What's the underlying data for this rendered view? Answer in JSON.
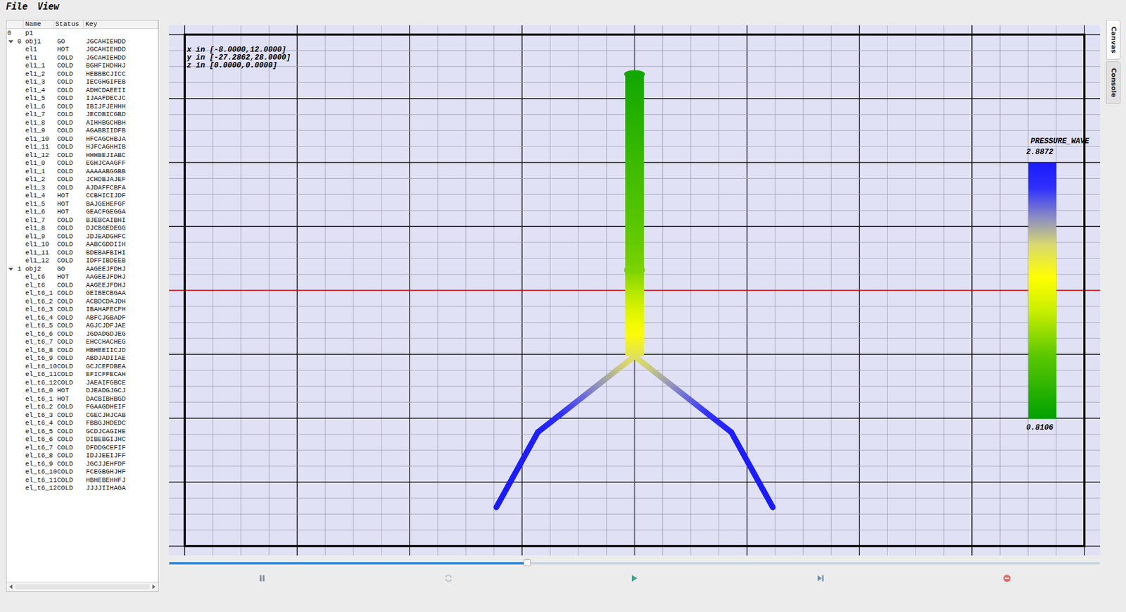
{
  "menu": [
    "File",
    "View"
  ],
  "tree": {
    "columns": [
      "Name",
      "Status",
      "Key"
    ],
    "rows": [
      {
        "kind": "root",
        "index": "0",
        "name": "p1"
      },
      {
        "kind": "group",
        "index": "0",
        "name": "obj1",
        "status": "GO",
        "key": "JGCAHIEHDD",
        "expanded": true
      },
      {
        "kind": "item",
        "name": "el1",
        "status": "HOT",
        "key": "JGCAHIEHDD"
      },
      {
        "kind": "item",
        "name": "el1",
        "status": "COLD",
        "key": "JGCAHIEHDD"
      },
      {
        "kind": "item",
        "name": "el1_1",
        "status": "COLD",
        "key": "BGHFIHDHHJ"
      },
      {
        "kind": "item",
        "name": "el1_2",
        "status": "COLD",
        "key": "HEBBBCJICC"
      },
      {
        "kind": "item",
        "name": "el1_3",
        "status": "COLD",
        "key": "IECGHGIFEB"
      },
      {
        "kind": "item",
        "name": "el1_4",
        "status": "COLD",
        "key": "ADHCDAEEII"
      },
      {
        "kind": "item",
        "name": "el1_5",
        "status": "COLD",
        "key": "IJAAFDECJC"
      },
      {
        "kind": "item",
        "name": "el1_6",
        "status": "COLD",
        "key": "IBIJFJEHHH"
      },
      {
        "kind": "item",
        "name": "el1_7",
        "status": "COLD",
        "key": "JECDBICGBD"
      },
      {
        "kind": "item",
        "name": "el1_8",
        "status": "COLD",
        "key": "AIHHBGCHBH"
      },
      {
        "kind": "item",
        "name": "el1_9",
        "status": "COLD",
        "key": "AGABBIIDFB"
      },
      {
        "kind": "item",
        "name": "el1_10",
        "status": "COLD",
        "key": "HFCAGCHBJA"
      },
      {
        "kind": "item",
        "name": "el1_11",
        "status": "COLD",
        "key": "HJFCAGHHIB"
      },
      {
        "kind": "item",
        "name": "el1_12",
        "status": "COLD",
        "key": "HHHBEJIABC"
      },
      {
        "kind": "item",
        "name": "el1_0",
        "status": "COLD",
        "key": "EGHJCAAGFF"
      },
      {
        "kind": "item",
        "name": "el1_1",
        "status": "COLD",
        "key": "AAAAABGGBB"
      },
      {
        "kind": "item",
        "name": "el1_2",
        "status": "COLD",
        "key": "JCHDBJAJEF"
      },
      {
        "kind": "item",
        "name": "el1_3",
        "status": "COLD",
        "key": "AJDAFFCBFA"
      },
      {
        "kind": "item",
        "name": "el1_4",
        "status": "HOT",
        "key": "CCBHICIJDF"
      },
      {
        "kind": "item",
        "name": "el1_5",
        "status": "HOT",
        "key": "BAJGEHEFGF"
      },
      {
        "kind": "item",
        "name": "el1_6",
        "status": "HOT",
        "key": "GEACFGEGGA"
      },
      {
        "kind": "item",
        "name": "el1_7",
        "status": "COLD",
        "key": "BJEBCAIBHI"
      },
      {
        "kind": "item",
        "name": "el1_8",
        "status": "COLD",
        "key": "DJCBGEDEGG"
      },
      {
        "kind": "item",
        "name": "el1_9",
        "status": "COLD",
        "key": "JDJEADGHFC"
      },
      {
        "kind": "item",
        "name": "el1_10",
        "status": "COLD",
        "key": "AABCGDDIIH"
      },
      {
        "kind": "item",
        "name": "el1_11",
        "status": "COLD",
        "key": "BDEBAFBIHI"
      },
      {
        "kind": "item",
        "name": "el1_12",
        "status": "COLD",
        "key": "IDFFIBDEEB"
      },
      {
        "kind": "group",
        "index": "1",
        "name": "obj2",
        "status": "GO",
        "key": "AAGEEJFDHJ",
        "expanded": true
      },
      {
        "kind": "item",
        "name": "el_t6",
        "status": "HOT",
        "key": "AAGEEJFDHJ"
      },
      {
        "kind": "item",
        "name": "el_t6",
        "status": "COLD",
        "key": "AAGEEJFDHJ"
      },
      {
        "kind": "item",
        "name": "el_t6_1",
        "status": "COLD",
        "key": "GEIBECBGAA"
      },
      {
        "kind": "item",
        "name": "el_t6_2",
        "status": "COLD",
        "key": "ACBDCDAJDH"
      },
      {
        "kind": "item",
        "name": "el_t6_3",
        "status": "COLD",
        "key": "IBAHAFECFH"
      },
      {
        "kind": "item",
        "name": "el_t6_4",
        "status": "COLD",
        "key": "ABFCJGBADF"
      },
      {
        "kind": "item",
        "name": "el_t6_5",
        "status": "COLD",
        "key": "AGJCJDFJAE"
      },
      {
        "kind": "item",
        "name": "el_t6_6",
        "status": "COLD",
        "key": "JGDADGDJEG"
      },
      {
        "kind": "item",
        "name": "el_t6_7",
        "status": "COLD",
        "key": "EHCCHACHEG"
      },
      {
        "kind": "item",
        "name": "el_t6_8",
        "status": "COLD",
        "key": "HBHEEIICJD"
      },
      {
        "kind": "item",
        "name": "el_t6_9",
        "status": "COLD",
        "key": "ABDJADIIAE"
      },
      {
        "kind": "item",
        "name": "el_t6_10",
        "status": "COLD",
        "key": "GCJCEFDBEA"
      },
      {
        "kind": "item",
        "name": "el_t6_11",
        "status": "COLD",
        "key": "EFICFFECAH"
      },
      {
        "kind": "item",
        "name": "el_t6_12",
        "status": "COLD",
        "key": "JAEAIFGBCE"
      },
      {
        "kind": "item",
        "name": "el_t6_0",
        "status": "HOT",
        "key": "DJEADGJGCJ"
      },
      {
        "kind": "item",
        "name": "el_t6_1",
        "status": "HOT",
        "key": "DACBIBHBGD"
      },
      {
        "kind": "item",
        "name": "el_t6_2",
        "status": "COLD",
        "key": "FGAAGDHEIF"
      },
      {
        "kind": "item",
        "name": "el_t6_3",
        "status": "COLD",
        "key": "CGECJHJCAB"
      },
      {
        "kind": "item",
        "name": "el_t6_4",
        "status": "COLD",
        "key": "FBBGJHDEDC"
      },
      {
        "kind": "item",
        "name": "el_t6_5",
        "status": "COLD",
        "key": "GCDJCAGIHE"
      },
      {
        "kind": "item",
        "name": "el_t6_6",
        "status": "COLD",
        "key": "DIBEBGIJHC"
      },
      {
        "kind": "item",
        "name": "el_t6_7",
        "status": "COLD",
        "key": "DFDDGCEFIF"
      },
      {
        "kind": "item",
        "name": "el_t6_8",
        "status": "COLD",
        "key": "IDJJEEIJFF"
      },
      {
        "kind": "item",
        "name": "el_t6_9",
        "status": "COLD",
        "key": "JGCJJEHFDF"
      },
      {
        "kind": "item",
        "name": "el_t6_10",
        "status": "COLD",
        "key": "FCEGBGHJHF"
      },
      {
        "kind": "item",
        "name": "el_t6_11",
        "status": "COLD",
        "key": "HBHEBEHHFJ"
      },
      {
        "kind": "item",
        "name": "el_t6_12",
        "status": "COLD",
        "key": "JJJJIIHAGA"
      }
    ]
  },
  "canvas": {
    "ranges": [
      "x in [-8.0000,12.0000]",
      "y in [-27.2862,28.0000]",
      "z in [0.0000,0.0000]"
    ],
    "legend": {
      "title": "PRESSURE_WAVE",
      "max": "2.8872",
      "min": "0.8106"
    },
    "segments": [
      {
        "kind": "trunk",
        "from": [
          2,
          28
        ],
        "to": [
          2,
          3
        ],
        "pressure": [
          0.91,
          1.43
        ]
      },
      {
        "kind": "trunk",
        "from": [
          2,
          3
        ],
        "to": [
          2,
          -8
        ],
        "pressure": [
          1.43,
          2.16
        ]
      },
      {
        "kind": "branch",
        "from": [
          2,
          -8
        ],
        "to": [
          -5,
          -17.7
        ],
        "pressure": [
          2.16,
          2.85
        ]
      },
      {
        "kind": "branch",
        "from": [
          -5,
          -17.7
        ],
        "to": [
          -8,
          -27.2862
        ],
        "pressure": [
          2.85,
          2.8872
        ]
      },
      {
        "kind": "branch",
        "from": [
          2,
          -8
        ],
        "to": [
          9,
          -17.7
        ],
        "pressure": [
          2.16,
          2.85
        ]
      },
      {
        "kind": "branch",
        "from": [
          9,
          -17.7
        ],
        "to": [
          12,
          -27.2862
        ],
        "pressure": [
          2.85,
          2.8872
        ]
      }
    ]
  },
  "player": {
    "level": 0.385,
    "controls": [
      {
        "kind": "pause",
        "disabled": false
      },
      {
        "kind": "refresh",
        "disabled": true
      },
      {
        "kind": "play",
        "disabled": false
      },
      {
        "kind": "step",
        "disabled": false
      },
      {
        "kind": "stop",
        "disabled": false
      }
    ]
  },
  "side_tabs": [
    {
      "label": "Canvas",
      "selected": true
    },
    {
      "label": "Console",
      "selected": false
    }
  ]
}
